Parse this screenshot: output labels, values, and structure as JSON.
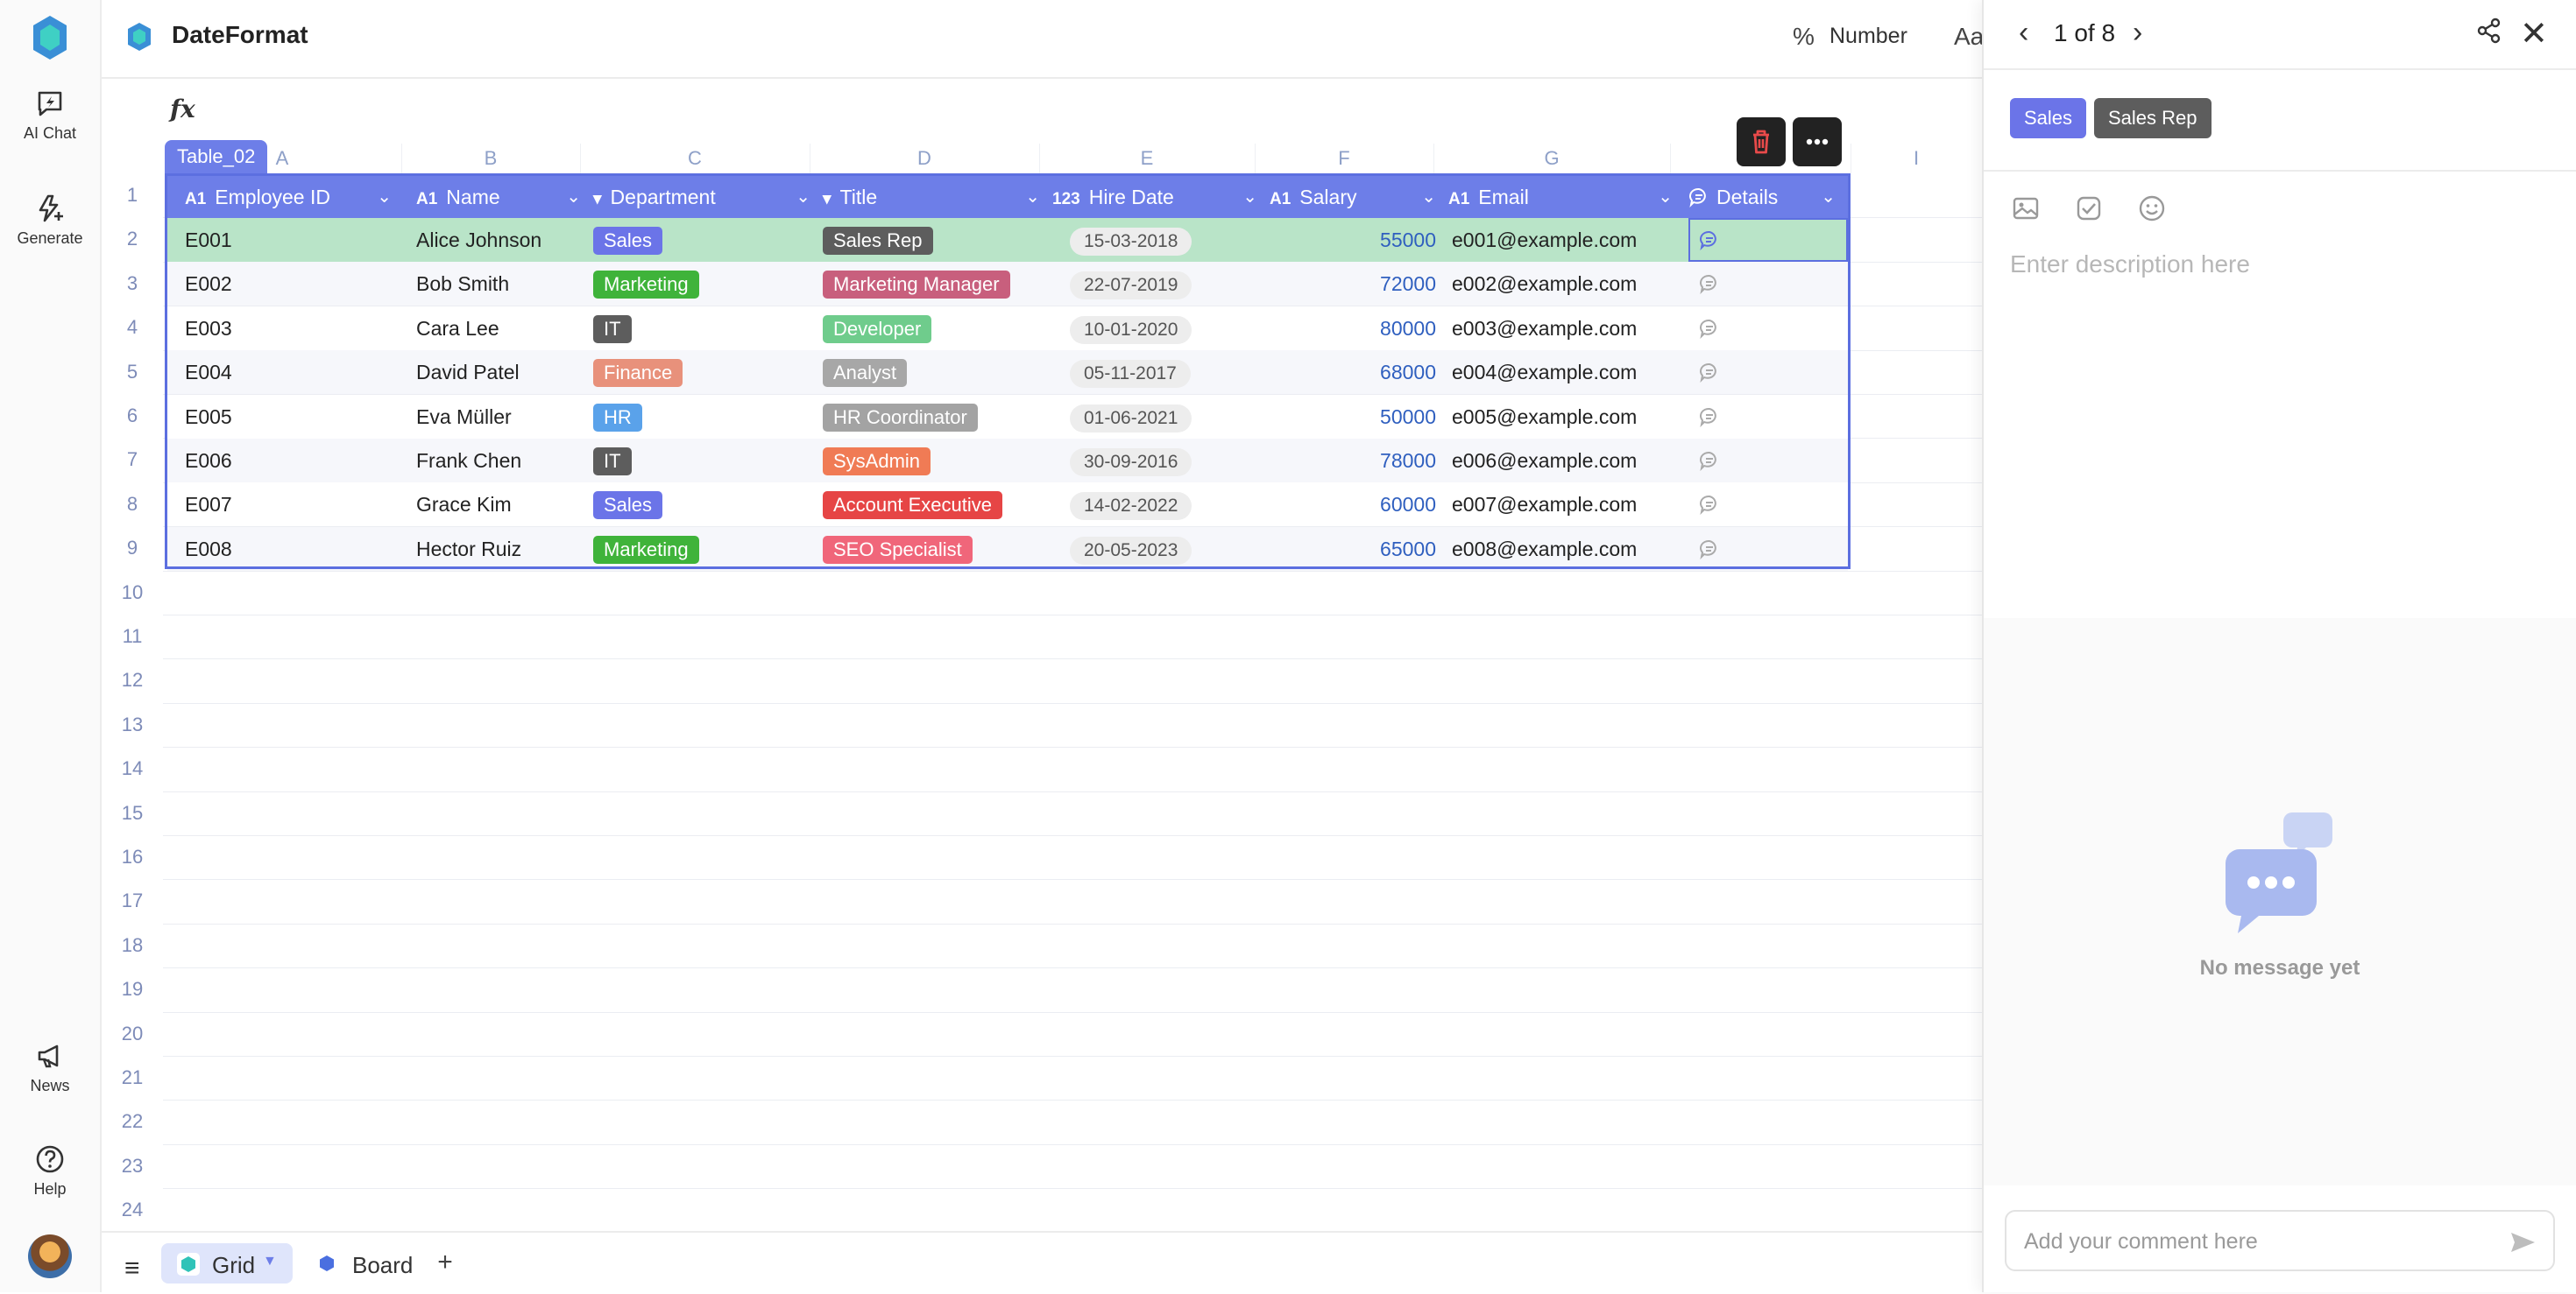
{
  "app": {
    "doc_title": "DateFormat"
  },
  "rail": {
    "ai_chat": "AI Chat",
    "generate": "Generate",
    "news": "News",
    "help": "Help"
  },
  "toolbar": {
    "percent_symbol": "%",
    "number_label": "Number",
    "text_format_symbol": "Aa"
  },
  "formula": {
    "fx": "fx"
  },
  "columns": [
    "A",
    "B",
    "C",
    "D",
    "E",
    "F",
    "G",
    "",
    "I"
  ],
  "row_numbers": [
    "1",
    "2",
    "3",
    "4",
    "5",
    "6",
    "7",
    "8",
    "9",
    "10",
    "11",
    "12",
    "13",
    "14",
    "15",
    "16",
    "17",
    "18",
    "19",
    "20",
    "21",
    "22",
    "23",
    "24"
  ],
  "table": {
    "name": "Table_02",
    "headers": [
      {
        "icon": "A1",
        "label": "Employee ID"
      },
      {
        "icon": "A1",
        "label": "Name"
      },
      {
        "icon": "▾",
        "label": "Department"
      },
      {
        "icon": "▾",
        "label": "Title"
      },
      {
        "icon": "123",
        "label": "Hire Date"
      },
      {
        "icon": "A1",
        "label": "Salary"
      },
      {
        "icon": "A1",
        "label": "Email"
      },
      {
        "icon": "comment-icon",
        "label": "Details"
      }
    ],
    "rows": [
      {
        "id": "E001",
        "name": "Alice Johnson",
        "dept": "Sales",
        "title": "Sales Rep",
        "hire": "15-03-2018",
        "salary": "55000",
        "email": "e001@example.com"
      },
      {
        "id": "E002",
        "name": "Bob Smith",
        "dept": "Marketing",
        "title": "Marketing Manager",
        "hire": "22-07-2019",
        "salary": "72000",
        "email": "e002@example.com"
      },
      {
        "id": "E003",
        "name": "Cara Lee",
        "dept": "IT",
        "title": "Developer",
        "hire": "10-01-2020",
        "salary": "80000",
        "email": "e003@example.com"
      },
      {
        "id": "E004",
        "name": "David Patel",
        "dept": "Finance",
        "title": "Analyst",
        "hire": "05-11-2017",
        "salary": "68000",
        "email": "e004@example.com"
      },
      {
        "id": "E005",
        "name": "Eva Müller",
        "dept": "HR",
        "title": "HR Coordinator",
        "hire": "01-06-2021",
        "salary": "50000",
        "email": "e005@example.com"
      },
      {
        "id": "E006",
        "name": "Frank Chen",
        "dept": "IT",
        "title": "SysAdmin",
        "hire": "30-09-2016",
        "salary": "78000",
        "email": "e006@example.com"
      },
      {
        "id": "E007",
        "name": "Grace Kim",
        "dept": "Sales",
        "title": "Account Executive",
        "hire": "14-02-2022",
        "salary": "60000",
        "email": "e007@example.com"
      },
      {
        "id": "E008",
        "name": "Hector Ruiz",
        "dept": "Marketing",
        "title": "SEO Specialist",
        "hire": "20-05-2023",
        "salary": "65000",
        "email": "e008@example.com"
      }
    ],
    "dept_colors": {
      "Sales": "#6b74e8",
      "Marketing": "#3fb33a",
      "IT": "#5d5d5d",
      "Finance": "#e8917b",
      "HR": "#5aa2ea"
    },
    "title_colors": {
      "Sales Rep": "#5d5d5d",
      "Marketing Manager": "#c85f7d",
      "Developer": "#6fcc8c",
      "Analyst": "#a7a7a7",
      "HR Coordinator": "#a3a3a3",
      "SysAdmin": "#f07b55",
      "Account Executive": "#e64545",
      "SEO Specialist": "#f0667a"
    }
  },
  "views": {
    "grid": "Grid",
    "board": "Board",
    "add": "+"
  },
  "panel": {
    "pager_text": "1 of 8",
    "tags": [
      {
        "label": "Sales",
        "color": "#6b74e8"
      },
      {
        "label": "Sales Rep",
        "color": "#5d5d5d"
      }
    ],
    "description_placeholder": "Enter description here",
    "no_message": "No message yet",
    "comment_placeholder": "Add your comment here"
  },
  "colors": {
    "accent": "#6d7ee8",
    "selected_row": "#b9e4c8",
    "salary_text": "#2f5fbf"
  }
}
